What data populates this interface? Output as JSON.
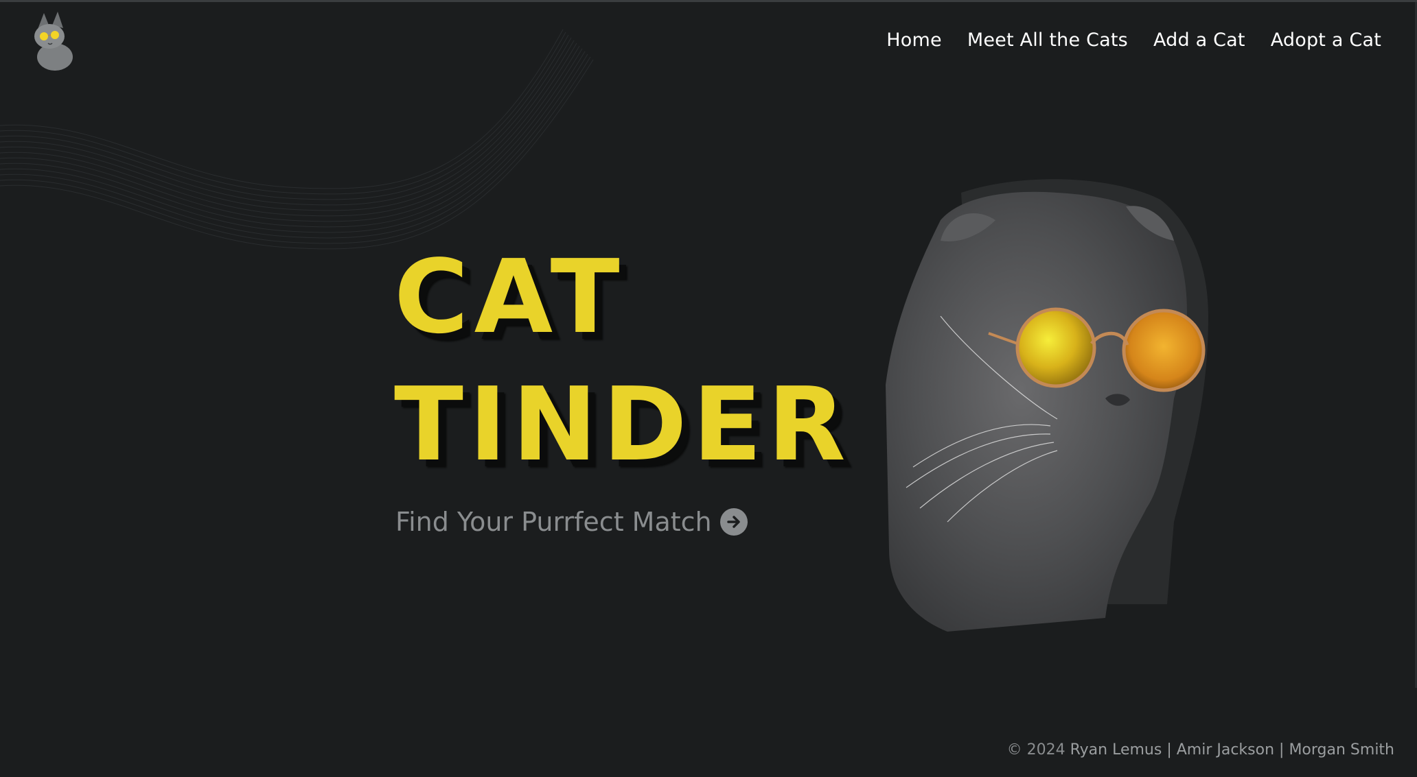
{
  "brand": {
    "logo_icon": "cat-with-sunglasses-logo-icon"
  },
  "nav": {
    "items": [
      {
        "label": "Home"
      },
      {
        "label": "Meet All the Cats"
      },
      {
        "label": "Add a Cat"
      },
      {
        "label": "Adopt a Cat"
      }
    ]
  },
  "hero": {
    "title_line_1": "CAT",
    "title_line_2": "TINDER",
    "cta_label": "Find Your Purrfect Match",
    "cta_icon": "arrow-right-circle-icon",
    "image_subject": "cat-with-sunglasses-photo"
  },
  "footer": {
    "copyright": "© 2024",
    "names": "Ryan Lemus | Amir Jackson | Morgan Smith"
  },
  "colors": {
    "background": "#1b1d1e",
    "accent_yellow": "#e9d32a",
    "muted_text": "#8a8d8f",
    "nav_text": "#ffffff"
  }
}
